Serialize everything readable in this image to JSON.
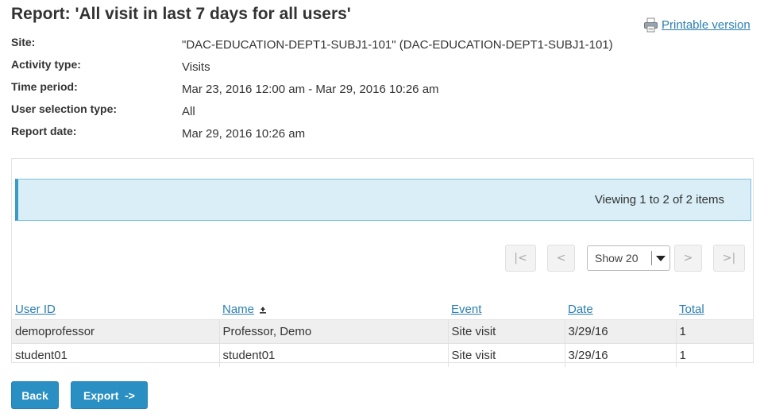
{
  "report": {
    "title": "Report: 'All visit in last 7 days for all users'",
    "printable_label": "Printable version"
  },
  "meta": [
    {
      "label": "Site:",
      "value": "\"DAC-EDUCATION-DEPT1-SUBJ1-101\" (DAC-EDUCATION-DEPT1-SUBJ1-101)"
    },
    {
      "label": "Activity type:",
      "value": "Visits"
    },
    {
      "label": "Time period:",
      "value": "Mar 23, 2016 12:00 am - Mar 29, 2016 10:26 am"
    },
    {
      "label": "User selection type:",
      "value": "All"
    },
    {
      "label": "Report date:",
      "value": "Mar 29, 2016 10:26 am"
    }
  ],
  "info": {
    "viewing": "Viewing 1 to 2 of 2 items"
  },
  "pager": {
    "first": "|<",
    "prev": "<",
    "show": "Show 20",
    "next": ">",
    "last": ">|"
  },
  "table": {
    "columns": [
      "User ID",
      "Name",
      "Event",
      "Date",
      "Total"
    ],
    "rows": [
      [
        "demoprofessor",
        "Professor, Demo",
        "Site visit",
        "3/29/16",
        "1"
      ],
      [
        "student01",
        "student01",
        "Site visit",
        "3/29/16",
        "1"
      ]
    ]
  },
  "buttons": {
    "back": "Back",
    "export": "Export  ->"
  },
  "colors": {
    "accent": "#2a8fc3",
    "link": "#2a7fb0",
    "info_bg": "#d9eef6"
  }
}
